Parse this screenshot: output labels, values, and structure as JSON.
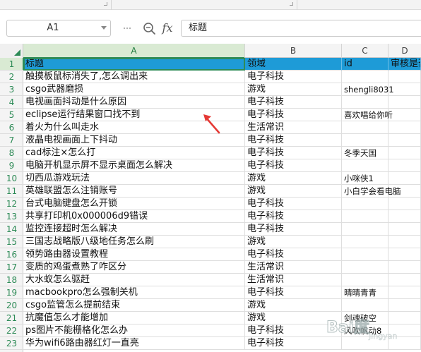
{
  "formula_bar": {
    "cell_ref": "A1",
    "fx_label": "fx",
    "content": "标题"
  },
  "columns": [
    {
      "letter": "A",
      "selected": true
    },
    {
      "letter": "B",
      "selected": false
    },
    {
      "letter": "C",
      "selected": false
    },
    {
      "letter": "D",
      "selected": false
    }
  ],
  "header_row": {
    "row_number": "1",
    "cells": [
      "标题",
      "领域",
      "id",
      "审核是否"
    ]
  },
  "rows": [
    {
      "n": "2",
      "title": "触摸板鼠标消失了,怎么调出来",
      "domain": "电子科技",
      "id": "",
      "status": ""
    },
    {
      "n": "3",
      "title": "csgo武器磨损",
      "domain": "游戏",
      "id": "shengli8031",
      "status": ""
    },
    {
      "n": "4",
      "title": "电视画面抖动是什么原因",
      "domain": "电子科技",
      "id": "",
      "status": ""
    },
    {
      "n": "5",
      "title": "eclipse运行结果窗口找不到",
      "domain": "电子科技",
      "id": "喜欢唱给你听",
      "status": ""
    },
    {
      "n": "6",
      "title": "着火为什么叫走水",
      "domain": "生活常识",
      "id": "",
      "status": ""
    },
    {
      "n": "7",
      "title": "液晶电视画面上下抖动",
      "domain": "电子科技",
      "id": "",
      "status": ""
    },
    {
      "n": "8",
      "title": "cad标注×怎么打",
      "domain": "电子科技",
      "id": "冬季天国",
      "status": ""
    },
    {
      "n": "9",
      "title": "电脑开机显示屏不显示桌面怎么解决",
      "domain": "电子科技",
      "id": "",
      "status": ""
    },
    {
      "n": "10",
      "title": "切西瓜游戏玩法",
      "domain": "游戏",
      "id": "小咪侠1",
      "status": ""
    },
    {
      "n": "11",
      "title": "英雄联盟怎么注销账号",
      "domain": "游戏",
      "id": "小白学会看电脑",
      "status": ""
    },
    {
      "n": "12",
      "title": "台式电脑键盘怎么开锁",
      "domain": "电子科技",
      "id": "",
      "status": ""
    },
    {
      "n": "13",
      "title": "共享打印机0x000006d9错误",
      "domain": "电子科技",
      "id": "",
      "status": ""
    },
    {
      "n": "14",
      "title": "监控连接超时怎么解决",
      "domain": "电子科技",
      "id": "",
      "status": ""
    },
    {
      "n": "15",
      "title": "三国志战略版八级地任务怎么刷",
      "domain": "游戏",
      "id": "",
      "status": ""
    },
    {
      "n": "16",
      "title": "领势路由器设置教程",
      "domain": "电子科技",
      "id": "",
      "status": ""
    },
    {
      "n": "17",
      "title": "变质的鸡蛋煮熟了咋区分",
      "domain": "生活常识",
      "id": "",
      "status": ""
    },
    {
      "n": "18",
      "title": "大水蚁怎么驱赶",
      "domain": "生活常识",
      "id": "",
      "status": ""
    },
    {
      "n": "19",
      "title": "macbookpro怎么强制关机",
      "domain": "电子科技",
      "id": "晴晴青青",
      "status": ""
    },
    {
      "n": "20",
      "title": "csgo监管怎么提前结束",
      "domain": "游戏",
      "id": "",
      "status": ""
    },
    {
      "n": "21",
      "title": "抗魔值怎么才能增加",
      "domain": "游戏",
      "id": "剑魂破空",
      "status": ""
    },
    {
      "n": "22",
      "title": "ps图片不能栅格化怎么办",
      "domain": "电子科技",
      "id": "风吹帆动8",
      "status": ""
    },
    {
      "n": "23",
      "title": "华为wifi6路由器红灯一直亮",
      "domain": "电子科技",
      "id": "",
      "status": ""
    }
  ],
  "watermark": {
    "text": "Bai度",
    "sub": "jingyan"
  },
  "colors": {
    "header_fill": "#1e9bd7",
    "accent": "#2e8b57",
    "arrow": "#e53935"
  }
}
